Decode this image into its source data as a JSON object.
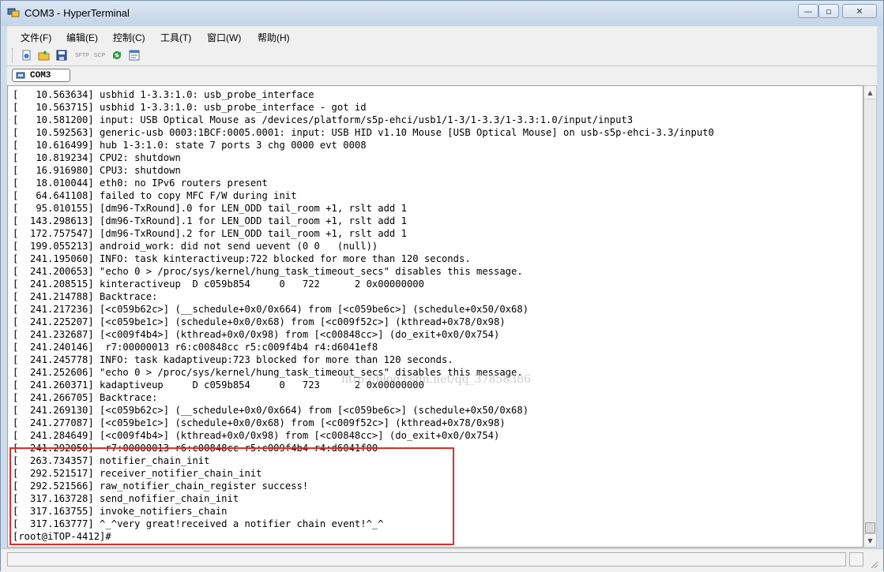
{
  "window": {
    "title": "COM3 - HyperTerminal",
    "minimize_label": "—",
    "restore_label": "▫",
    "close_label": "✕"
  },
  "menu": {
    "items": [
      {
        "label": "文件(F)"
      },
      {
        "label": "编辑(E)"
      },
      {
        "label": "控制(C)"
      },
      {
        "label": "工具(T)"
      },
      {
        "label": "窗口(W)"
      },
      {
        "label": "帮助(H)"
      }
    ]
  },
  "toolbar": {
    "buttons": [
      {
        "icon": "new-connection-icon"
      },
      {
        "icon": "open-folder-icon"
      },
      {
        "icon": "save-icon"
      },
      {
        "icon": "sftp-icon",
        "label": "SFTP"
      },
      {
        "icon": "scp-icon",
        "label": "SCP"
      },
      {
        "icon": "refresh-icon"
      },
      {
        "icon": "properties-icon"
      }
    ]
  },
  "tab": {
    "label": "COM3"
  },
  "terminal": {
    "lines": [
      "[   10.563634] usbhid 1-3.3:1.0: usb_probe_interface",
      "[   10.563715] usbhid 1-3.3:1.0: usb_probe_interface - got id",
      "[   10.581200] input: USB Optical Mouse as /devices/platform/s5p-ehci/usb1/1-3/1-3.3/1-3.3:1.0/input/input3",
      "[   10.592563] generic-usb 0003:1BCF:0005.0001: input: USB HID v1.10 Mouse [USB Optical Mouse] on usb-s5p-ehci-3.3/input0",
      "[   10.616499] hub 1-3:1.0: state 7 ports 3 chg 0000 evt 0008",
      "[   10.819234] CPU2: shutdown",
      "[   16.916980] CPU3: shutdown",
      "[   18.010044] eth0: no IPv6 routers present",
      "[   64.641108] failed to copy MFC F/W during init",
      "[   95.010155] [dm96-TxRound].0 for LEN_ODD tail_room +1, rslt add 1",
      "[  143.298613] [dm96-TxRound].1 for LEN_ODD tail_room +1, rslt add 1",
      "[  172.757547] [dm96-TxRound].2 for LEN_ODD tail_room +1, rslt add 1",
      "[  199.055213] android_work: did not send uevent (0 0   (null))",
      "[  241.195060] INFO: task kinteractiveup:722 blocked for more than 120 seconds.",
      "[  241.200653] \"echo 0 > /proc/sys/kernel/hung_task_timeout_secs\" disables this message.",
      "[  241.208515] kinteractiveup  D c059b854     0   722      2 0x00000000",
      "[  241.214788] Backtrace:",
      "[  241.217236] [<c059b62c>] (__schedule+0x0/0x664) from [<c059be6c>] (schedule+0x50/0x68)",
      "[  241.225207] [<c059be1c>] (schedule+0x0/0x68) from [<c009f52c>] (kthread+0x78/0x98)",
      "[  241.232687] [<c009f4b4>] (kthread+0x0/0x98) from [<c00848cc>] (do_exit+0x0/0x754)",
      "[  241.240146]  r7:00000013 r6:c00848cc r5:c009f4b4 r4:d6041ef8",
      "[  241.245778] INFO: task kadaptiveup:723 blocked for more than 120 seconds.",
      "[  241.252606] \"echo 0 > /proc/sys/kernel/hung_task_timeout_secs\" disables this message.",
      "[  241.260371] kadaptiveup     D c059b854     0   723      2 0x00000000",
      "[  241.266705] Backtrace:",
      "[  241.269130] [<c059b62c>] (__schedule+0x0/0x664) from [<c059be6c>] (schedule+0x50/0x68)",
      "[  241.277087] [<c059be1c>] (schedule+0x0/0x68) from [<c009f52c>] (kthread+0x78/0x98)",
      "[  241.284649] [<c009f4b4>] (kthread+0x0/0x98) from [<c00848cc>] (do_exit+0x0/0x754)",
      "[  241.292050]  r7:00000013 r6:c00848cc r5:c009f4b4 r4:d6041f00",
      "[  263.734357] notifier_chain_init",
      "[  292.521517] receiver_notifier_chain_init",
      "[  292.521566] raw_notifier_chain_register success!",
      "[  317.163728] send_nofifier_chain_init",
      "[  317.163755] invoke_notifiers_chain",
      "[  317.163777] ^_^very great!received a notifier chain event!^_^"
    ],
    "prompt": "[root@iTOP-4412]#",
    "watermark": "http://blog.csdn.net/qq_37858386"
  },
  "colors": {
    "highlight_border": "#e32b2b",
    "titlebar": "#c3d4e8"
  }
}
